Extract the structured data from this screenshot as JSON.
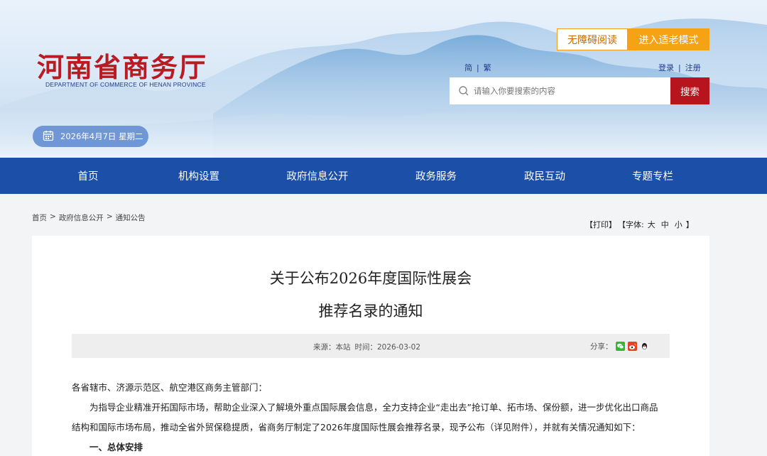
{
  "header": {
    "logo_title": "河南省商务厅",
    "logo_subtitle": "DEPARTMENT OF COMMERCE OF HENAN PROVINCE",
    "accessible_label": "无障碍阅读",
    "elder_mode_label": "进入适老模式",
    "lang": {
      "simplified": "简",
      "separator": "|",
      "traditional": "繁"
    },
    "user": {
      "login": "登录",
      "separator": "|",
      "register": "注册"
    },
    "search": {
      "placeholder": "请输入你要搜索的内容",
      "button": "搜索",
      "icon": "search-icon"
    },
    "date": "2026年4月7日 星期二",
    "colors": {
      "brand_red": "#b81c22",
      "nav_blue": "#1b4fa8",
      "elder_orange": "#f5a315"
    }
  },
  "nav": {
    "items": [
      "首页",
      "机构设置",
      "政府信息公开",
      "政务服务",
      "政民互动",
      "专题专栏"
    ]
  },
  "breadcrumb": {
    "items": [
      "首页",
      "政府信息公开",
      "通知公告"
    ],
    "separator": ">"
  },
  "tools": {
    "print": "【打印】",
    "font_label": "【字体:",
    "large": "大",
    "medium": "中",
    "small": "小",
    "close": "】"
  },
  "article": {
    "title_line1": "关于公布2026年度国际性展会",
    "title_line2": "推荐名录的通知",
    "source": "来源：本站",
    "time": "时间：2026-03-02",
    "share_label": "分享：",
    "share_icons": [
      "wechat-icon",
      "weibo-icon",
      "qq-icon"
    ],
    "salutation": "各省辖市、济源示范区、航空港区商务主管部门：",
    "para1_line1": "为指导企业精准开拓国际市场，帮助企业深入了解境外重点国际展会信息，全力支持企业“走出去”抢订单、拓市场、保份额，进一步优化出口商品",
    "para1_line2": "结构和国际市场布局，推动全省外贸保稳提质，省商务厅制定了2026年度国际性展会推荐名录，现予公布（详见附件），并就有关情况通知如下：",
    "section1": "一、总体安排"
  }
}
